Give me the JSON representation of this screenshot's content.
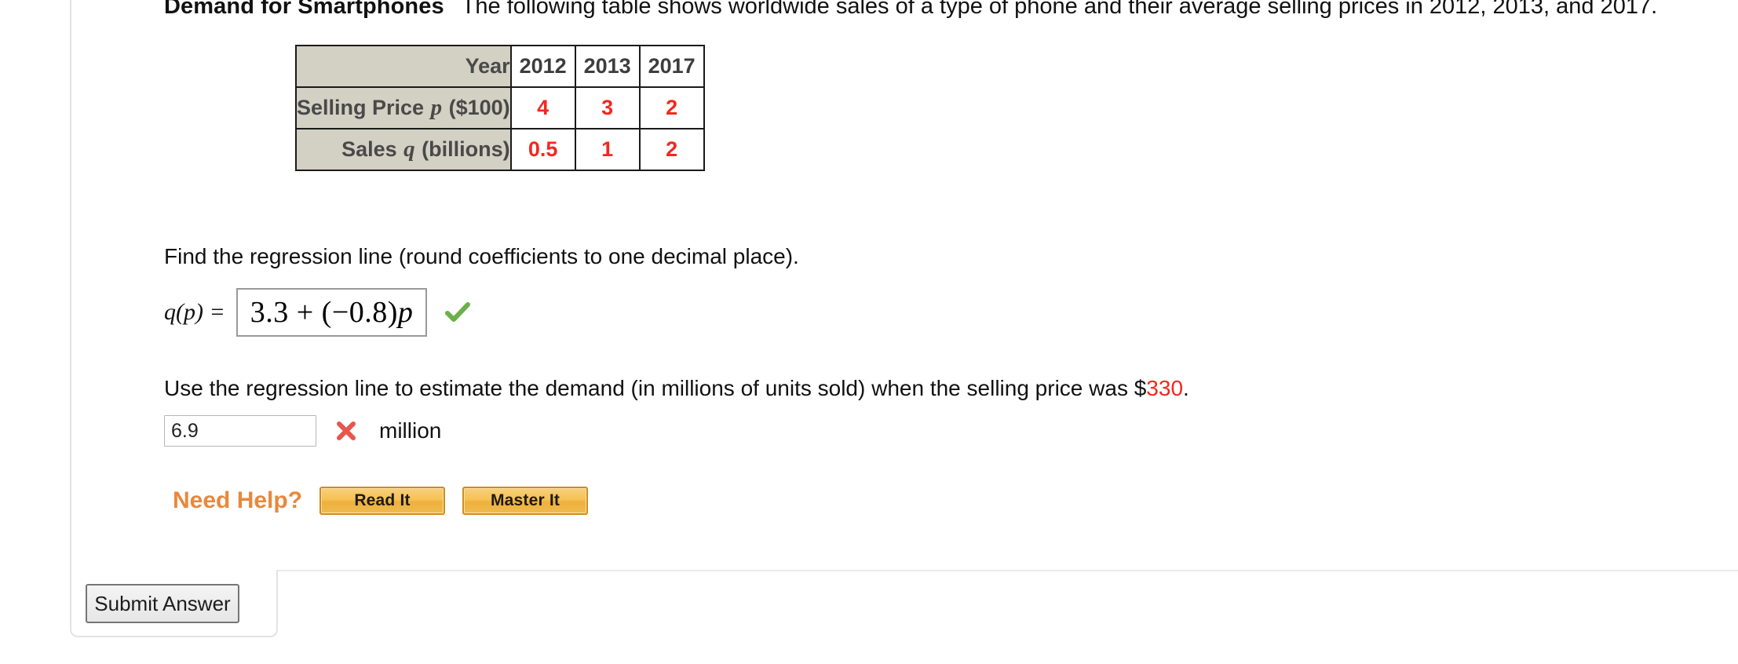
{
  "problem": {
    "title": "Demand for Smartphones",
    "intro": "The following table shows worldwide sales of a type of phone and their average selling prices in 2012, 2013, and 2017."
  },
  "table": {
    "corner_label": "Year",
    "year_columns": [
      "2012",
      "2013",
      "2017"
    ],
    "rows": [
      {
        "label_prefix": "Selling Price",
        "label_var": "p",
        "label_suffix": "($100)",
        "values": [
          "4",
          "3",
          "2"
        ]
      },
      {
        "label_prefix": "Sales",
        "label_var": "q",
        "label_suffix": "(billions)",
        "values": [
          "0.5",
          "1",
          "2"
        ]
      }
    ]
  },
  "part_a": {
    "prompt": "Find the regression line (round coefficients to one decimal place).",
    "function_label": "q(p) =",
    "answer_intercept": "3.3 + (−0.8)",
    "answer_variable": "p",
    "status_icon": "check-icon",
    "status_color": "#6cb04c"
  },
  "part_b": {
    "prompt_before": "Use the regression line to estimate the demand (in millions of units sold) when the selling price was $",
    "prompt_value": "330",
    "prompt_after": ".",
    "input_value": "6.9",
    "unit_label": "million",
    "status_icon": "x-icon",
    "status_color": "#e8554d"
  },
  "help": {
    "label": "Need Help?",
    "buttons": [
      "Read It",
      "Master It"
    ]
  },
  "footer": {
    "submit_label": "Submit Answer"
  },
  "colors": {
    "red_value": "#f3271f",
    "table_header_bg": "#d3d0c4",
    "need_help_orange": "#e9883b"
  }
}
